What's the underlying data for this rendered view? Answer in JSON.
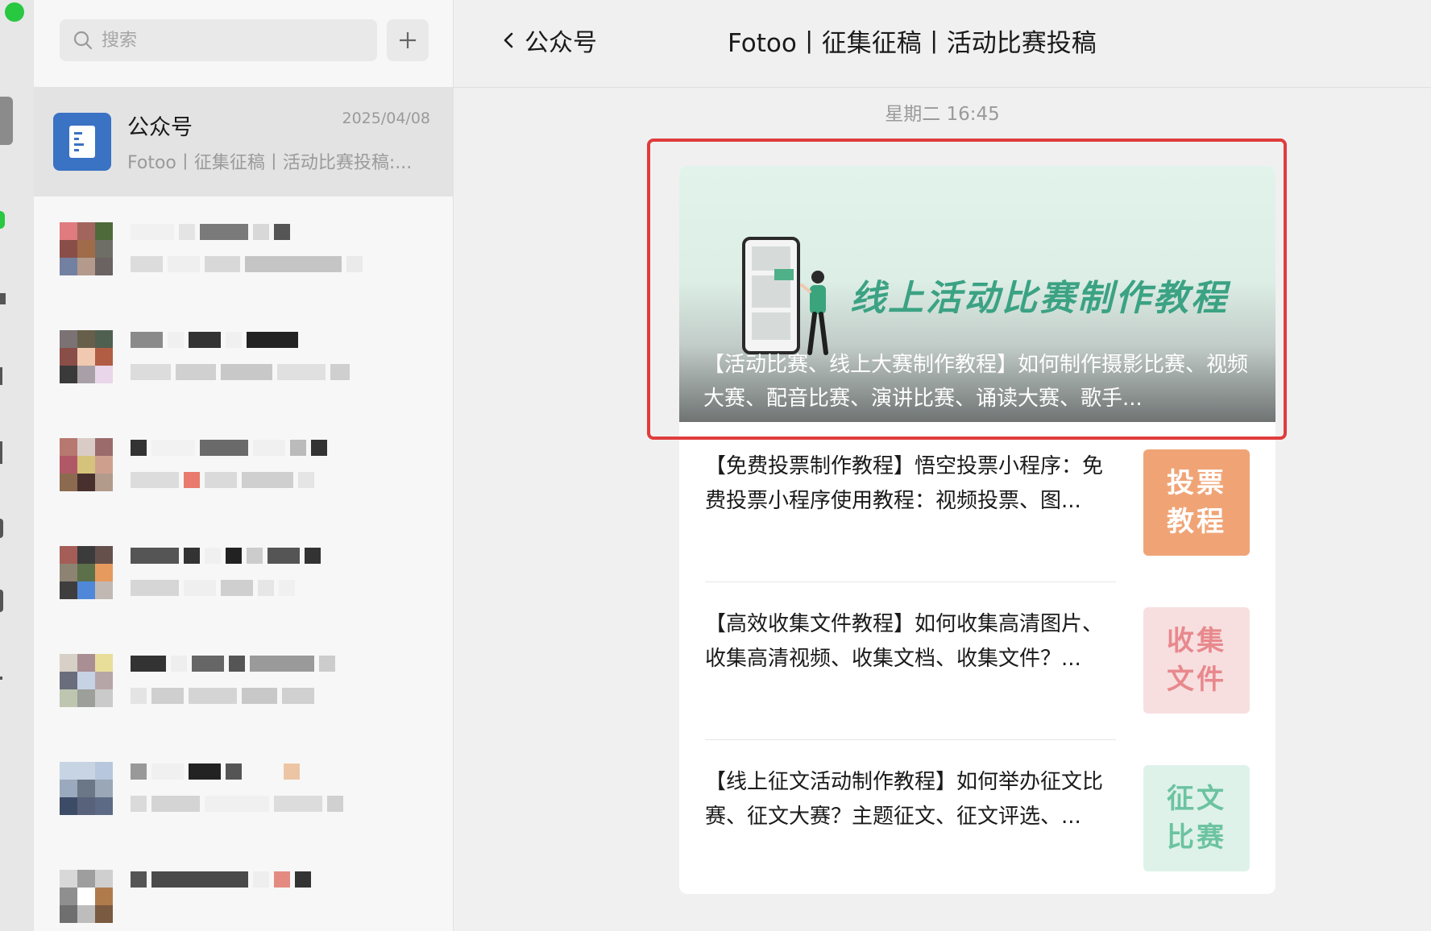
{
  "sidebar": {
    "search": {
      "placeholder": "搜索"
    },
    "conversation": {
      "name": "公众号",
      "date": "2025/04/08",
      "preview": "Fotoo丨征集征稿丨活动比赛投稿:..."
    }
  },
  "header": {
    "back_label": "公众号",
    "title": "Fotoo丨征集征稿丨活动比赛投稿"
  },
  "chat": {
    "timestamp": "星期二 16:45",
    "cover": {
      "headline": "线上活动比赛制作教程",
      "caption": "【活动比赛、线上大赛制作教程】如何制作摄影比赛、视频大赛、配音比赛、演讲比赛、诵读大赛、歌手..."
    },
    "articles": [
      {
        "text": "【免费投票制作教程】悟空投票小程序：免费投票小程序使用教程：视频投票、图...",
        "thumb": "投票\n教程",
        "thumb_color": "#f0a476",
        "thumb_text_color": "#ffffff"
      },
      {
        "text": "【高效收集文件教程】如何收集高清图片、收集高清视频、收集文档、收集文件？...",
        "thumb": "收集\n文件",
        "thumb_color": "#f7dfe0",
        "thumb_text_color": "#e8898d"
      },
      {
        "text": "【线上征文活动制作教程】如何举办征文比赛、征文大赛？主题征文、征文评选、...",
        "thumb": "征文\n比赛",
        "thumb_color": "#def2ea",
        "thumb_text_color": "#6cc3a0"
      }
    ]
  },
  "colors": {
    "highlight": "#e03c3c",
    "accent_green": "#3ba283",
    "window_green": "#28c840",
    "avatar_blue": "#3a72c4"
  }
}
